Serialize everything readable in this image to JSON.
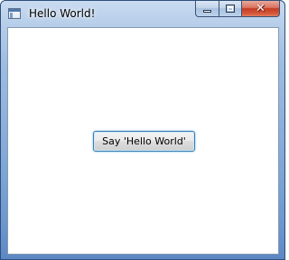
{
  "window": {
    "title": "Hello World!",
    "icon": "app-window-icon",
    "caption_buttons": {
      "minimize_icon": "minimize-icon",
      "maximize_icon": "maximize-icon",
      "close_glyph": "✕"
    }
  },
  "content": {
    "button_label": "Say 'Hello World'"
  },
  "colors": {
    "frame_accent": "#7ea6d6",
    "close_button": "#c43a22",
    "button_focus_border": "#3c7fb1"
  }
}
